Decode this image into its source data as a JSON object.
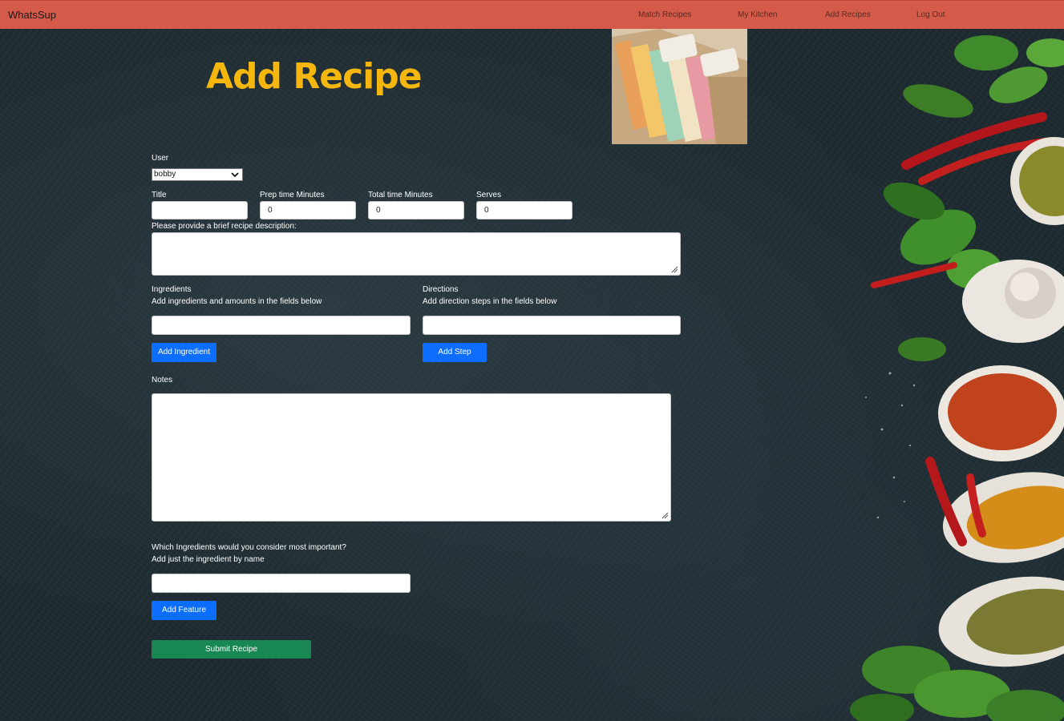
{
  "nav": {
    "brand": "WhatsSup",
    "links": [
      "Match Recipes",
      "My Kitchen",
      "Add Recipes",
      "Log Out"
    ]
  },
  "page": {
    "title": "Add Recipe"
  },
  "form": {
    "user_label": "User",
    "user_value": "bobby",
    "title_label": "Title",
    "title_value": "",
    "prep_label": "Prep time Minutes",
    "prep_value": "0",
    "total_label": "Total time Minutes",
    "total_value": "0",
    "serves_label": "Serves",
    "serves_value": "0",
    "description_label": "Please provide a brief recipe description:",
    "ingredients_label": "Ingredients",
    "ingredients_hint": "Add ingredients and amounts in the fields below",
    "add_ingredient": "Add Ingredient",
    "directions_label": "Directions",
    "directions_hint": "Add direction steps in the fields below",
    "add_step": "Add Step",
    "notes_label": "Notes",
    "features_label": "Which Ingredients would you consider most important?",
    "features_hint": "Add just the ingredient by name",
    "add_feature": "Add Feature",
    "submit": "Submit Recipe"
  },
  "colors": {
    "navbar": "#d45a4a",
    "title": "#f5b70e",
    "primary": "#0d6efd",
    "success": "#198754"
  }
}
